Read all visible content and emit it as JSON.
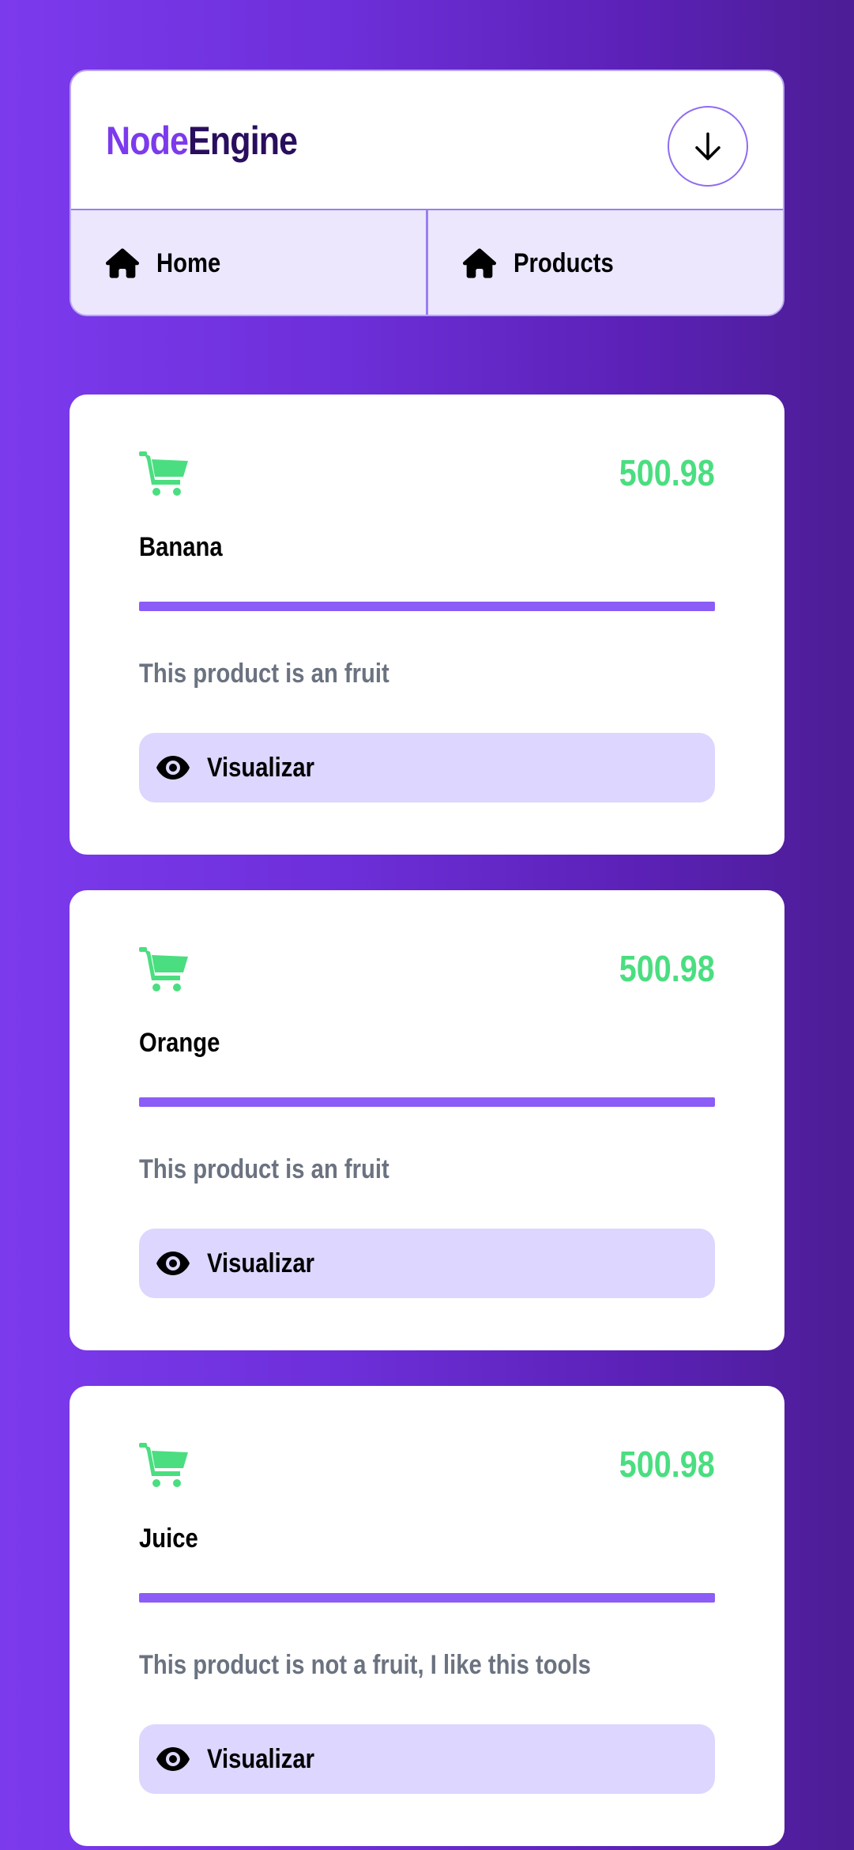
{
  "header": {
    "logo_part1": "Node",
    "logo_part2": "Engine",
    "menu_icon": "arrow-down-icon",
    "nav": [
      {
        "label": "Home",
        "icon": "home-icon"
      },
      {
        "label": "Products",
        "icon": "home-icon"
      }
    ]
  },
  "products": [
    {
      "name": "Banana",
      "price": "500.98",
      "description": "This product is an fruit",
      "button_label": "Visualizar"
    },
    {
      "name": "Orange",
      "price": "500.98",
      "description": "This product is an fruit",
      "button_label": "Visualizar"
    },
    {
      "name": "Juice",
      "price": "500.98",
      "description": "This product is not a fruit, I like this tools",
      "button_label": "Visualizar"
    }
  ],
  "colors": {
    "brand": "#7c3aed",
    "brand_dark": "#2a0e5e",
    "price": "#4ade80",
    "divider": "#8b5cf6",
    "button_bg": "#ddd6fe"
  }
}
